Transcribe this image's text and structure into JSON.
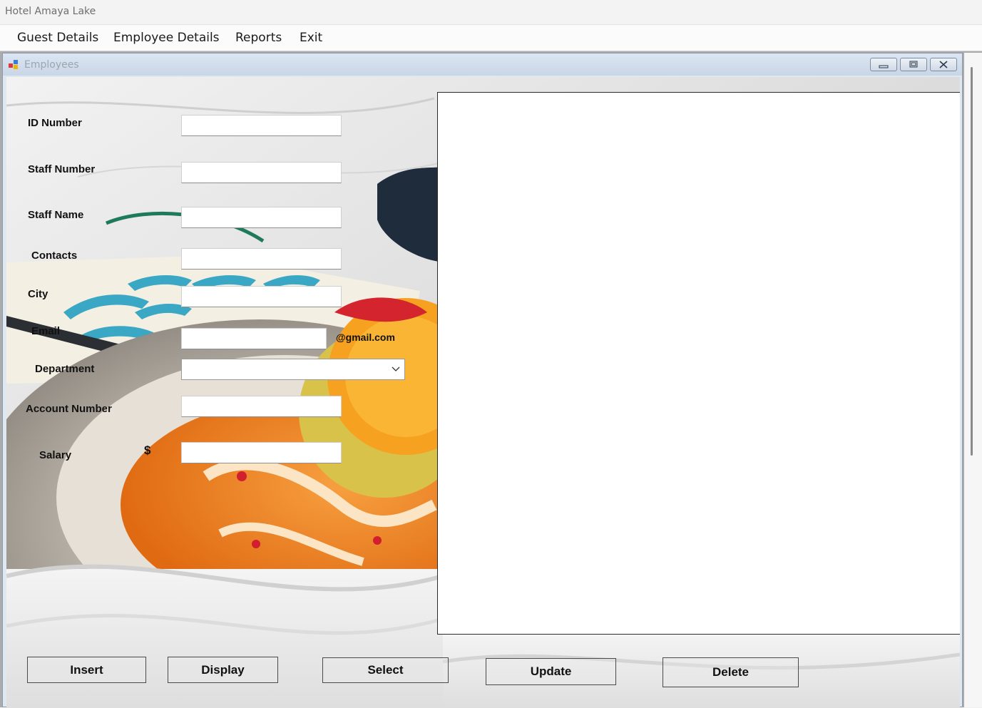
{
  "app": {
    "title": "Hotel Amaya Lake"
  },
  "menu": {
    "items": [
      "Guest Details",
      "Employee Details",
      "Reports",
      "Exit"
    ]
  },
  "child_window": {
    "title": "Employees"
  },
  "form": {
    "id_number_label": "ID Number",
    "staff_number_label": "Staff Number",
    "staff_name_label": "Staff Name",
    "contacts_label": "Contacts",
    "city_label": "City",
    "email_label": "Email",
    "email_suffix": "@gmail.com",
    "department_label": "Department",
    "department_value": "",
    "account_number_label": "Account Number",
    "salary_label": "Salary",
    "currency_symbol": "$",
    "id_number_value": "",
    "staff_number_value": "",
    "staff_name_value": "",
    "contacts_value": "",
    "city_value": "",
    "email_value": "",
    "account_number_value": "",
    "salary_value": ""
  },
  "buttons": {
    "insert": "Insert",
    "display": "Display",
    "select": "Select",
    "update": "Update",
    "delete": "Delete"
  },
  "icons": {
    "app_window_icon": "form-window-icon",
    "minimize": "minimize-icon",
    "restore": "restore-icon",
    "close": "close-icon",
    "department_dropdown": "chevron-down-icon"
  },
  "colors": {
    "window_title_bg": "#dce6f2",
    "grid_bg": "#ffffff"
  }
}
